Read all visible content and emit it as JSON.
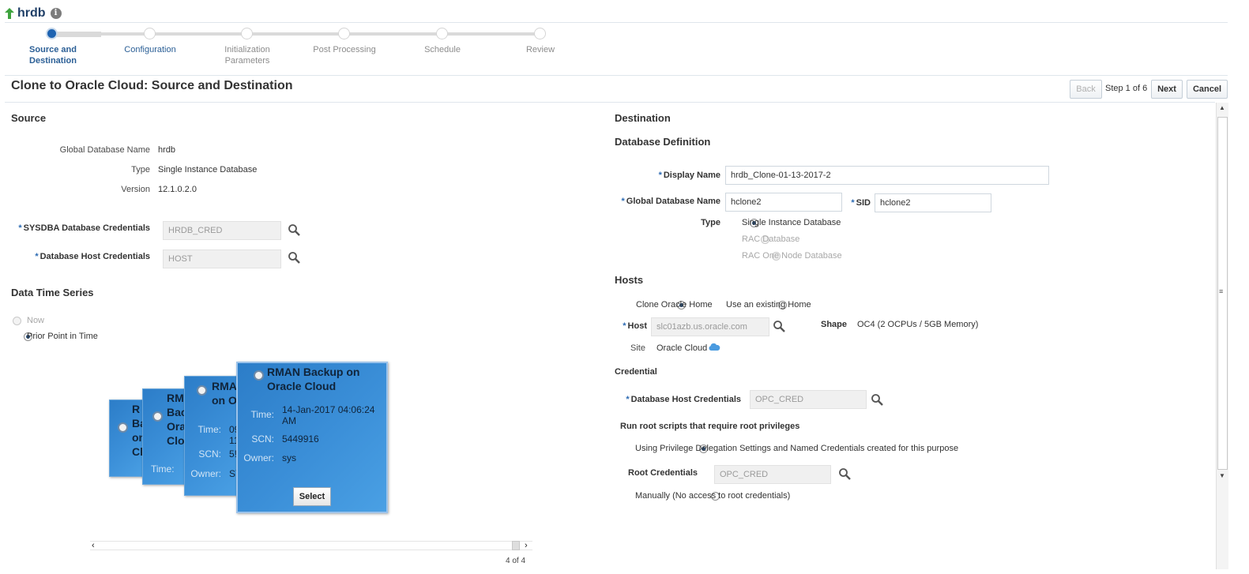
{
  "header": {
    "title": "hrdb",
    "info_icon": "info-icon",
    "up_icon": "up-arrow-icon"
  },
  "train": {
    "steps": [
      {
        "label_line1": "Source and",
        "label_line2": "Destination",
        "state": "active"
      },
      {
        "label_line1": "Configuration",
        "label_line2": "",
        "state": "link"
      },
      {
        "label_line1": "Initialization",
        "label_line2": "Parameters",
        "state": "disabled"
      },
      {
        "label_line1": "Post Processing",
        "label_line2": "",
        "state": "disabled"
      },
      {
        "label_line1": "Schedule",
        "label_line2": "",
        "state": "disabled"
      },
      {
        "label_line1": "Review",
        "label_line2": "",
        "state": "disabled"
      }
    ]
  },
  "page": {
    "title": "Clone to Oracle Cloud: Source and Destination",
    "back_label": "Back",
    "step_text": "Step 1 of 6",
    "next_label": "Next",
    "cancel_label": "Cancel"
  },
  "source": {
    "heading": "Source",
    "global_db_name_label": "Global Database Name",
    "global_db_name_value": "hrdb",
    "type_label": "Type",
    "type_value": "Single Instance Database",
    "version_label": "Version",
    "version_value": "12.1.0.2.0",
    "sysdba_label": "SYSDBA Database Credentials",
    "sysdba_value": "HRDB_CRED",
    "host_cred_label": "Database Host Credentials",
    "host_cred_value": "HOST",
    "required_mark": "*"
  },
  "time_series": {
    "heading": "Data Time Series",
    "option_now": "Now",
    "option_prior": "Prior Point in Time",
    "selected": "prior"
  },
  "backups": {
    "time_key": "Time:",
    "scn_key": "SCN:",
    "owner_key": "Owner:",
    "select_label": "Select",
    "card1": {
      "title_l1": "R",
      "title_l2": "Ba",
      "title_l3": "on",
      "title_l4": "Cl"
    },
    "card2": {
      "title_l1": "RM",
      "title_l2": "Bac",
      "title_l3": "Ora",
      "title_l4": "Clo"
    },
    "card3": {
      "title_l1": "RMA",
      "title_l2": "on O",
      "time_l1": "09",
      "time_l2": "11",
      "scn": "5!",
      "owner": "SY"
    },
    "card4": {
      "title_l1": "RMAN Backup on",
      "title_l2": "Oracle Cloud",
      "time_l1": "14-Jan-2017 04:06:24",
      "time_l2": "AM",
      "scn": "5449916",
      "owner": "sys"
    },
    "pager": "4 of 4"
  },
  "destination": {
    "heading": "Destination",
    "db_def_heading": "Database Definition",
    "display_name_label": "Display Name",
    "display_name_value": "hrdb_Clone-01-13-2017-2",
    "global_db_name_label": "Global Database Name",
    "global_db_name_value": "hclone2",
    "sid_label": "SID",
    "sid_value": "hclone2",
    "type_label": "Type",
    "type_options": [
      "Single Instance Database",
      "RAC Database",
      "RAC One Node Database"
    ],
    "hosts_heading": "Hosts",
    "home_option_clone": "Clone Oracle Home",
    "home_option_existing": "Use an existing Home",
    "host_label": "Host",
    "host_value": "slc01azb.us.oracle.com",
    "shape_label": "Shape",
    "shape_value": "OC4 (2 OCPUs / 5GB Memory)",
    "site_label": "Site",
    "site_value": "Oracle Cloud",
    "credential_heading": "Credential",
    "db_host_cred_label": "Database Host Credentials",
    "db_host_cred_value": "OPC_CRED",
    "root_scripts_heading": "Run root scripts that require root privileges",
    "root_option_delegation": "Using Privilege Delegation Settings and Named Credentials created for this purpose",
    "root_cred_label": "Root Credentials",
    "root_cred_value": "OPC_CRED",
    "root_option_manual": "Manually (No access to root credentials)"
  },
  "colors": {
    "accent": "#1e63b1",
    "card_blue": "#3b8fd8",
    "required": "#2d6bb3"
  }
}
